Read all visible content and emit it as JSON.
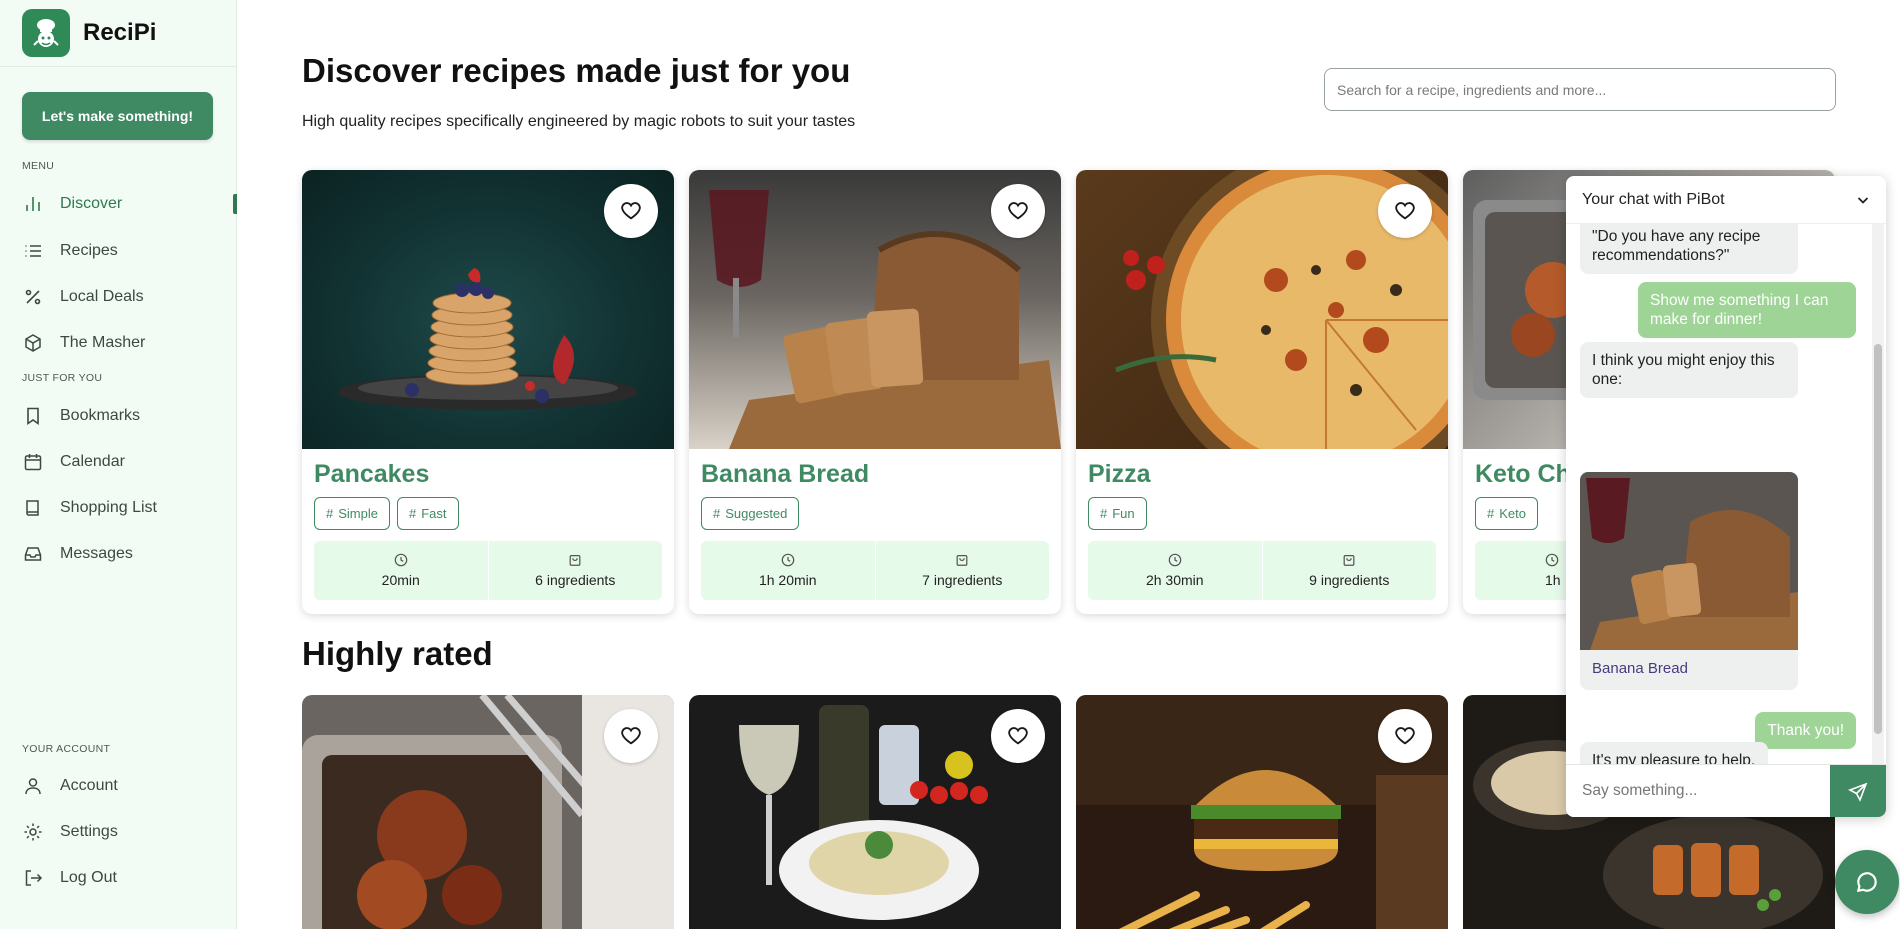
{
  "app": {
    "name": "ReciPi"
  },
  "sidebar": {
    "cta_label": "Let's make something!",
    "menu_label": "MENU",
    "menu": [
      {
        "label": "Discover",
        "icon": "bar-chart-icon",
        "active": true
      },
      {
        "label": "Recipes",
        "icon": "list-icon"
      },
      {
        "label": "Local Deals",
        "icon": "percent-icon"
      },
      {
        "label": "The Masher",
        "icon": "box-icon"
      }
    ],
    "just_for_you_label": "JUST FOR YOU",
    "personal": [
      {
        "label": "Bookmarks",
        "icon": "bookmark-icon"
      },
      {
        "label": "Calendar",
        "icon": "calendar-icon"
      },
      {
        "label": "Shopping List",
        "icon": "book-icon"
      },
      {
        "label": "Messages",
        "icon": "inbox-icon"
      }
    ],
    "account_label": "YOUR ACCOUNT",
    "account": [
      {
        "label": "Account",
        "icon": "user-icon"
      },
      {
        "label": "Settings",
        "icon": "gear-icon"
      },
      {
        "label": "Log Out",
        "icon": "logout-icon"
      }
    ]
  },
  "header": {
    "title": "Discover recipes made just for you",
    "subtitle": "High quality recipes specifically engineered by magic robots to suit your tastes",
    "search_placeholder": "Search for a recipe, ingredients and more..."
  },
  "recipes": [
    {
      "title": "Pancakes",
      "tags": [
        "Simple",
        "Fast"
      ],
      "time": "20min",
      "ingredients": "6 ingredients"
    },
    {
      "title": "Banana Bread",
      "tags": [
        "Suggested"
      ],
      "time": "1h 20min",
      "ingredients": "7 ingredients"
    },
    {
      "title": "Pizza",
      "tags": [
        "Fun"
      ],
      "time": "2h 30min",
      "ingredients": "9 ingredients"
    },
    {
      "title": "Keto Chi",
      "tags": [
        "Keto"
      ],
      "time": "1h",
      "ingredients": ""
    }
  ],
  "highly_rated": {
    "title": "Highly rated"
  },
  "chat": {
    "title": "Your chat with PiBot",
    "messages": [
      {
        "from": "bot",
        "text": "\"Do you have any recipe recommendations?\""
      },
      {
        "from": "user",
        "text": "Show me something I can make for dinner!"
      },
      {
        "from": "bot",
        "text": "I think you might enjoy this one:"
      },
      {
        "from": "bot",
        "card": "Banana Bread"
      },
      {
        "from": "user",
        "text": "Thank you!"
      },
      {
        "from": "bot",
        "text": "It's my pleasure to help."
      }
    ],
    "input_placeholder": "Say something..."
  },
  "colors": {
    "brand": "#3f8a63",
    "sidebar_bg": "#f3fbf5",
    "stats_bg": "#e6faea",
    "user_bubble": "#9ed496"
  }
}
